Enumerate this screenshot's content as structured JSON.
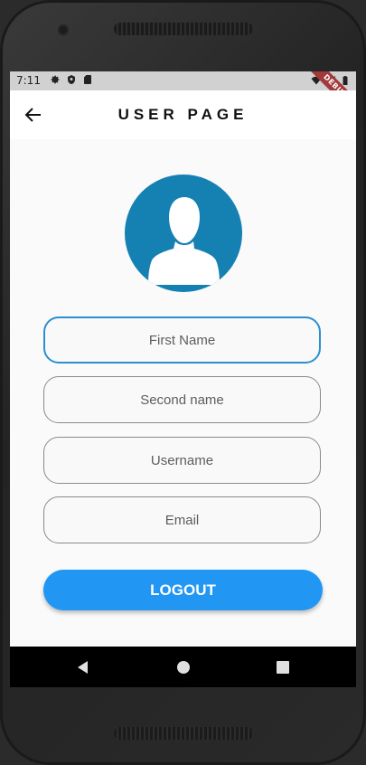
{
  "status_bar": {
    "time": "7:11",
    "icons": [
      "settings-icon",
      "shield-icon",
      "sd-card-icon"
    ],
    "right_icons": [
      "wifi-icon",
      "signal-icon",
      "battery-icon"
    ]
  },
  "debug_banner": "DEBUG",
  "app_bar": {
    "title": "USER PAGE",
    "back_icon": "arrow-back-icon"
  },
  "avatar": {
    "icon": "person-icon",
    "color": "#1581b2"
  },
  "form": {
    "first_name": {
      "placeholder": "First Name",
      "value": ""
    },
    "second_name": {
      "placeholder": "Second name",
      "value": ""
    },
    "username": {
      "placeholder": "Username",
      "value": ""
    },
    "email": {
      "placeholder": "Email",
      "value": ""
    }
  },
  "logout_label": "LOGOUT",
  "colors": {
    "accent": "#2196f3",
    "focus_border": "#2b8fcf",
    "avatar_bg": "#1581b2"
  },
  "nav_bar": {
    "buttons": [
      "back-triangle-icon",
      "home-circle-icon",
      "recents-square-icon"
    ]
  }
}
